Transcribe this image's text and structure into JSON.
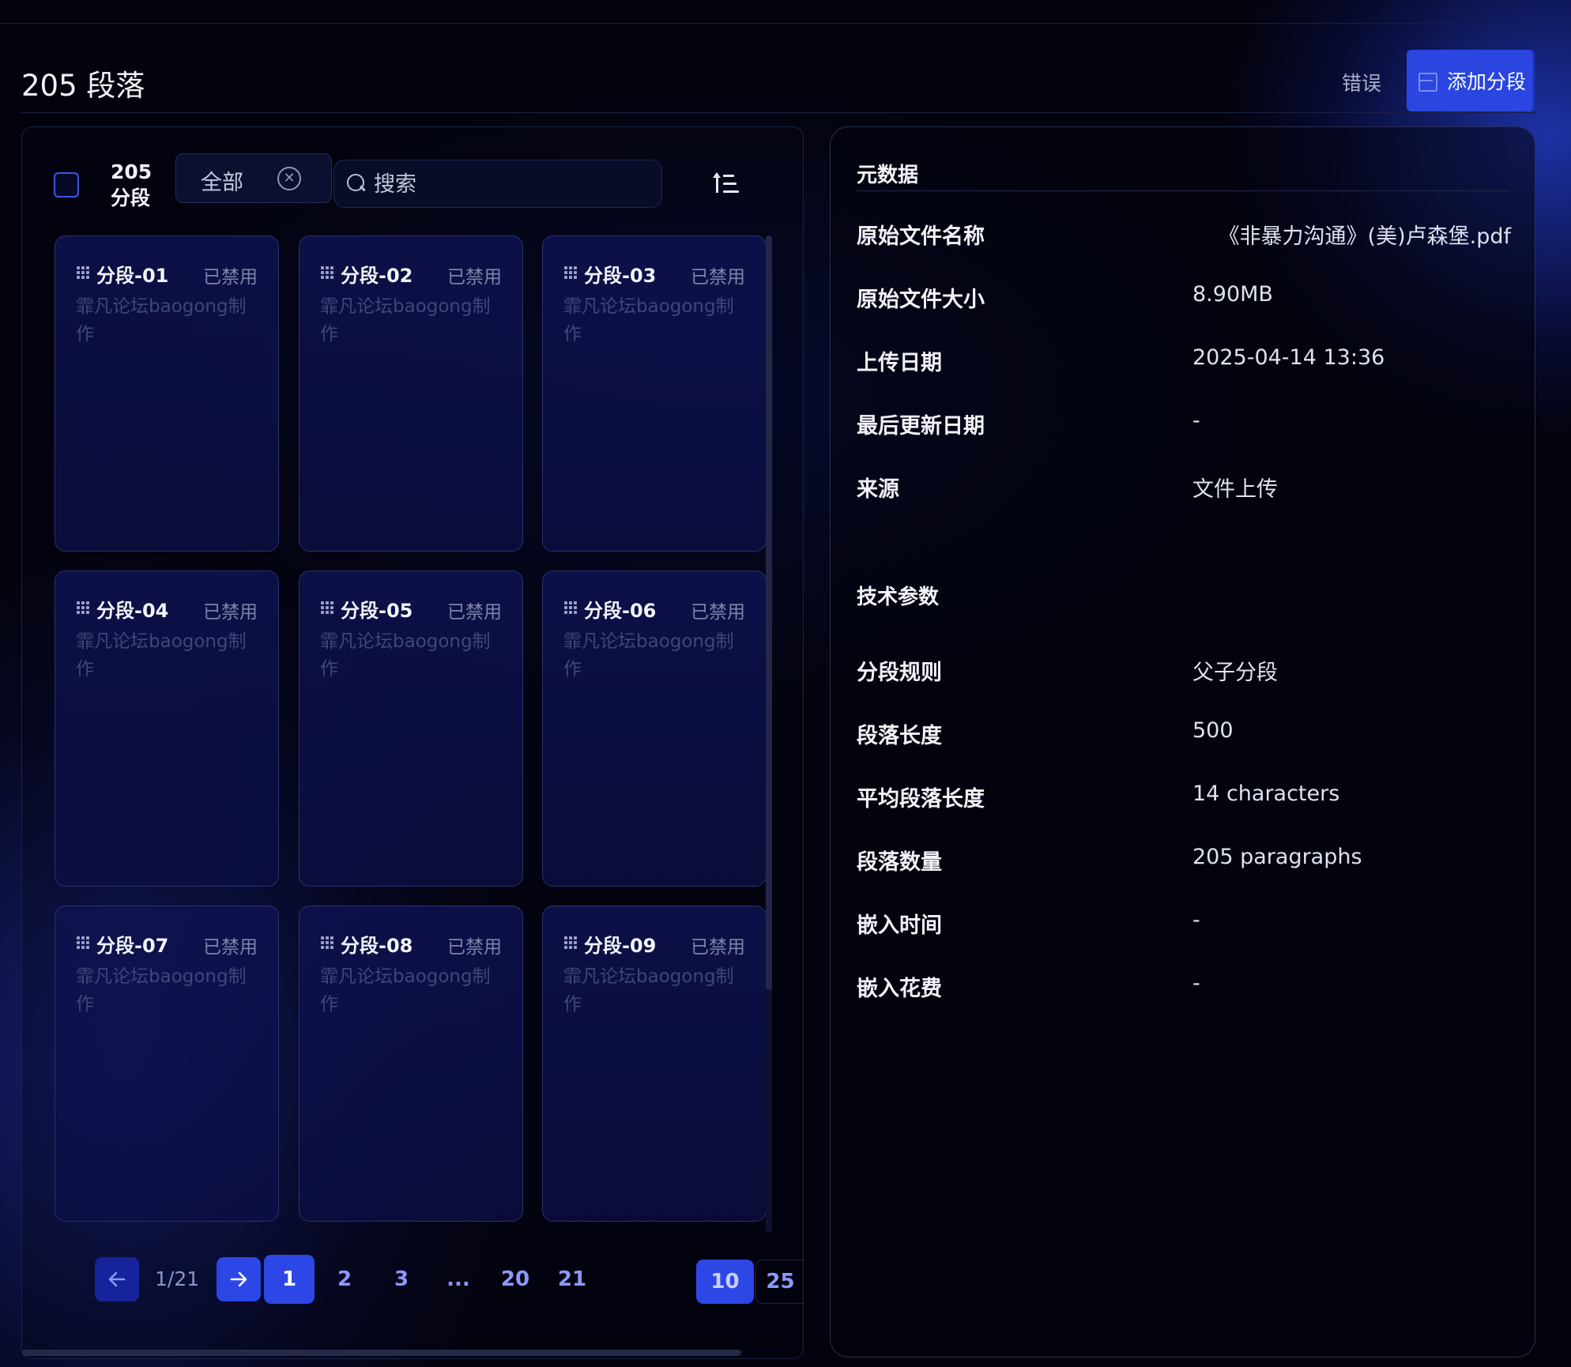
{
  "header": {
    "title": "205 段落",
    "error_label": "错误",
    "add_button_label": "添加分段"
  },
  "list": {
    "count_label": "205 分段",
    "filter_value": "全部",
    "search_placeholder": "搜索",
    "segments": [
      {
        "title": "分段-01",
        "status": "已禁用",
        "body": "霏凡论坛baogong制作"
      },
      {
        "title": "分段-02",
        "status": "已禁用",
        "body": "霏凡论坛baogong制作"
      },
      {
        "title": "分段-03",
        "status": "已禁用",
        "body": "霏凡论坛baogong制作"
      },
      {
        "title": "分段-04",
        "status": "已禁用",
        "body": "霏凡论坛baogong制作"
      },
      {
        "title": "分段-05",
        "status": "已禁用",
        "body": "霏凡论坛baogong制作"
      },
      {
        "title": "分段-06",
        "status": "已禁用",
        "body": "霏凡论坛baogong制作"
      },
      {
        "title": "分段-07",
        "status": "已禁用",
        "body": "霏凡论坛baogong制作"
      },
      {
        "title": "分段-08",
        "status": "已禁用",
        "body": "霏凡论坛baogong制作"
      },
      {
        "title": "分段-09",
        "status": "已禁用",
        "body": "霏凡论坛baogong制作"
      }
    ]
  },
  "pagination": {
    "page_fraction": "1/21",
    "pages": [
      "1",
      "2",
      "3",
      "...",
      "20",
      "21"
    ],
    "current_page": "1",
    "page_sizes": [
      "10",
      "25"
    ],
    "current_size": "10"
  },
  "metadata": {
    "section_title": "元数据",
    "rows": [
      {
        "label": "原始文件名称",
        "value": "《非暴力沟通》(美)卢森堡.pdf"
      },
      {
        "label": "原始文件大小",
        "value": "8.90MB"
      },
      {
        "label": "上传日期",
        "value": "2025-04-14 13:36"
      },
      {
        "label": "最后更新日期",
        "value": "-"
      },
      {
        "label": "来源",
        "value": "文件上传"
      }
    ]
  },
  "tech_params": {
    "section_title": "技术参数",
    "rows": [
      {
        "label": "分段规则",
        "value": "父子分段"
      },
      {
        "label": "段落长度",
        "value": "500"
      },
      {
        "label": "平均段落长度",
        "value": "14 characters"
      },
      {
        "label": "段落数量",
        "value": "205 paragraphs"
      },
      {
        "label": "嵌入时间",
        "value": "-"
      },
      {
        "label": "嵌入花费",
        "value": "-"
      }
    ]
  },
  "colors": {
    "accent": "#2d47e6",
    "background": "#03030d",
    "card_border": "#2b326e",
    "muted_text": "#3f4679"
  }
}
